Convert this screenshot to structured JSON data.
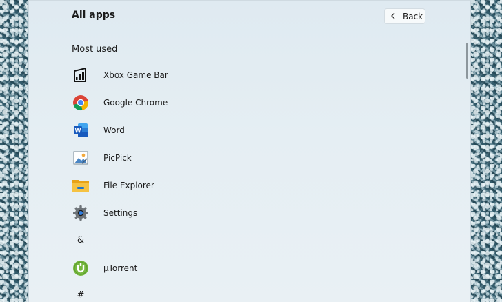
{
  "start_menu": {
    "title": "All apps",
    "back_label": "Back",
    "section_label": "Most used",
    "most_used": [
      {
        "label": "Xbox Game Bar",
        "icon": "xbox-game-bar-icon"
      },
      {
        "label": "Google Chrome",
        "icon": "google-chrome-icon"
      },
      {
        "label": "Word",
        "icon": "word-icon"
      },
      {
        "label": "PicPick",
        "icon": "picpick-icon"
      },
      {
        "label": "File Explorer",
        "icon": "file-explorer-icon"
      },
      {
        "label": "Settings",
        "icon": "settings-gear-icon"
      }
    ],
    "group_amp": "&",
    "group_amp_apps": [
      {
        "label": "µTorrent",
        "icon": "utorrent-icon"
      }
    ],
    "group_hash": "#"
  },
  "colors": {
    "panel_bg": "#e5eef3",
    "word_blue": "#185abd",
    "utorrent_green": "#76b83f",
    "explorer_yellow": "#f5c242"
  }
}
